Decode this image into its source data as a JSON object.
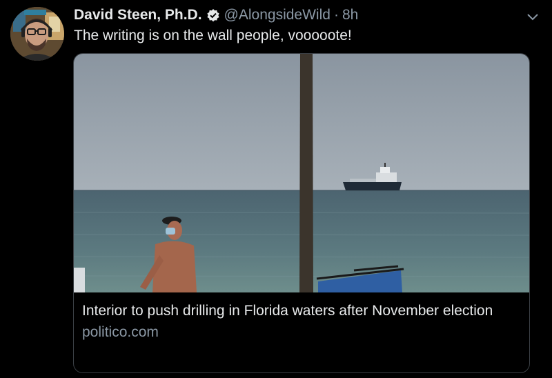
{
  "author": {
    "display_name": "David Steen, Ph.D.",
    "handle": "@AlongsideWild",
    "separator": "·",
    "time": "8h",
    "verified_icon": "verified-badge-icon"
  },
  "tweet": {
    "text": "The writing is on the wall people, vooooote!"
  },
  "card": {
    "title": "Interior to push drilling in Florida waters after November election",
    "domain": "politico.com"
  },
  "colors": {
    "background": "#000000",
    "primary_text": "#e7e9ea",
    "secondary_text": "#8b98a5",
    "card_border": "#3a3f44"
  },
  "icons": {
    "menu": "chevron-down-icon",
    "verified": "verified-badge-icon"
  }
}
